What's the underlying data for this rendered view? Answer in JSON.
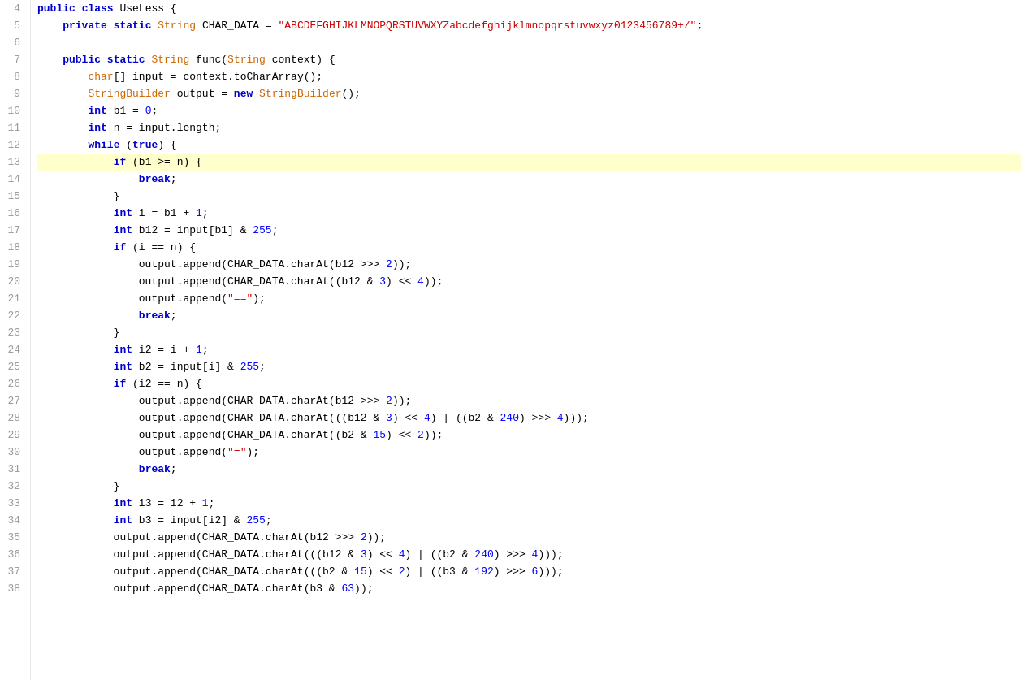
{
  "editor": {
    "lines": [
      {
        "num": 4,
        "highlighted": false,
        "tokens": [
          {
            "t": "kw",
            "v": "public"
          },
          {
            "t": "op",
            "v": " "
          },
          {
            "t": "kw",
            "v": "class"
          },
          {
            "t": "op",
            "v": " "
          },
          {
            "t": "classname",
            "v": "UseLess"
          },
          {
            "t": "op",
            "v": " {"
          }
        ]
      },
      {
        "num": 5,
        "highlighted": false,
        "tokens": [
          {
            "t": "op",
            "v": "    "
          },
          {
            "t": "kw",
            "v": "private"
          },
          {
            "t": "op",
            "v": " "
          },
          {
            "t": "kw",
            "v": "static"
          },
          {
            "t": "op",
            "v": " "
          },
          {
            "t": "type",
            "v": "String"
          },
          {
            "t": "op",
            "v": " CHAR_DATA = "
          },
          {
            "t": "str",
            "v": "\"ABCDEFGHIJKLMNOPQRSTUVWXYZabcdefghijklmnopqrstuvwxyz0123456789+/\""
          },
          {
            "t": "op",
            "v": ";"
          }
        ]
      },
      {
        "num": 6,
        "highlighted": false,
        "tokens": []
      },
      {
        "num": 7,
        "highlighted": false,
        "tokens": [
          {
            "t": "op",
            "v": "    "
          },
          {
            "t": "kw",
            "v": "public"
          },
          {
            "t": "op",
            "v": " "
          },
          {
            "t": "kw",
            "v": "static"
          },
          {
            "t": "op",
            "v": " "
          },
          {
            "t": "type",
            "v": "String"
          },
          {
            "t": "op",
            "v": " func("
          },
          {
            "t": "type",
            "v": "String"
          },
          {
            "t": "op",
            "v": " context) {"
          }
        ]
      },
      {
        "num": 8,
        "highlighted": false,
        "tokens": [
          {
            "t": "op",
            "v": "        "
          },
          {
            "t": "type",
            "v": "char"
          },
          {
            "t": "op",
            "v": "[] input = context.toCharArray();"
          }
        ]
      },
      {
        "num": 9,
        "highlighted": false,
        "tokens": [
          {
            "t": "op",
            "v": "        "
          },
          {
            "t": "type",
            "v": "StringBuilder"
          },
          {
            "t": "op",
            "v": " output = "
          },
          {
            "t": "kw",
            "v": "new"
          },
          {
            "t": "op",
            "v": " "
          },
          {
            "t": "type",
            "v": "StringBuilder"
          },
          {
            "t": "op",
            "v": "();"
          }
        ]
      },
      {
        "num": 10,
        "highlighted": false,
        "tokens": [
          {
            "t": "op",
            "v": "        "
          },
          {
            "t": "kw",
            "v": "int"
          },
          {
            "t": "op",
            "v": " b1 = "
          },
          {
            "t": "num",
            "v": "0"
          },
          {
            "t": "op",
            "v": ";"
          }
        ]
      },
      {
        "num": 11,
        "highlighted": false,
        "tokens": [
          {
            "t": "op",
            "v": "        "
          },
          {
            "t": "kw",
            "v": "int"
          },
          {
            "t": "op",
            "v": " n = input.length;"
          }
        ]
      },
      {
        "num": 12,
        "highlighted": false,
        "tokens": [
          {
            "t": "op",
            "v": "        "
          },
          {
            "t": "kw",
            "v": "while"
          },
          {
            "t": "op",
            "v": " ("
          },
          {
            "t": "kw",
            "v": "true"
          },
          {
            "t": "op",
            "v": ") {"
          }
        ]
      },
      {
        "num": 13,
        "highlighted": true,
        "tokens": [
          {
            "t": "op",
            "v": "            "
          },
          {
            "t": "kw",
            "v": "if"
          },
          {
            "t": "op",
            "v": " (b1 >= n) {"
          }
        ]
      },
      {
        "num": 14,
        "highlighted": false,
        "tokens": [
          {
            "t": "op",
            "v": "                "
          },
          {
            "t": "kw",
            "v": "break"
          },
          {
            "t": "op",
            "v": ";"
          }
        ]
      },
      {
        "num": 15,
        "highlighted": false,
        "tokens": [
          {
            "t": "op",
            "v": "            }"
          }
        ]
      },
      {
        "num": 16,
        "highlighted": false,
        "tokens": [
          {
            "t": "op",
            "v": "            "
          },
          {
            "t": "kw",
            "v": "int"
          },
          {
            "t": "op",
            "v": " i = b1 + "
          },
          {
            "t": "num",
            "v": "1"
          },
          {
            "t": "op",
            "v": ";"
          }
        ]
      },
      {
        "num": 17,
        "highlighted": false,
        "tokens": [
          {
            "t": "op",
            "v": "            "
          },
          {
            "t": "kw",
            "v": "int"
          },
          {
            "t": "op",
            "v": " b12 = input[b1] & "
          },
          {
            "t": "num",
            "v": "255"
          },
          {
            "t": "op",
            "v": ";"
          }
        ]
      },
      {
        "num": 18,
        "highlighted": false,
        "tokens": [
          {
            "t": "op",
            "v": "            "
          },
          {
            "t": "kw",
            "v": "if"
          },
          {
            "t": "op",
            "v": " (i == n) {"
          }
        ]
      },
      {
        "num": 19,
        "highlighted": false,
        "tokens": [
          {
            "t": "op",
            "v": "                output.append(CHAR_DATA.charAt(b12 >>> "
          },
          {
            "t": "num",
            "v": "2"
          },
          {
            "t": "op",
            "v": "));"
          }
        ]
      },
      {
        "num": 20,
        "highlighted": false,
        "tokens": [
          {
            "t": "op",
            "v": "                output.append(CHAR_DATA.charAt((b12 & "
          },
          {
            "t": "num",
            "v": "3"
          },
          {
            "t": "op",
            "v": ") << "
          },
          {
            "t": "num",
            "v": "4"
          },
          {
            "t": "op",
            "v": "));"
          }
        ]
      },
      {
        "num": 21,
        "highlighted": false,
        "tokens": [
          {
            "t": "op",
            "v": "                output.append("
          },
          {
            "t": "str",
            "v": "\"==\""
          },
          {
            "t": "op",
            "v": ");"
          }
        ]
      },
      {
        "num": 22,
        "highlighted": false,
        "tokens": [
          {
            "t": "op",
            "v": "                "
          },
          {
            "t": "kw",
            "v": "break"
          },
          {
            "t": "op",
            "v": ";"
          }
        ]
      },
      {
        "num": 23,
        "highlighted": false,
        "tokens": [
          {
            "t": "op",
            "v": "            }"
          }
        ]
      },
      {
        "num": 24,
        "highlighted": false,
        "tokens": [
          {
            "t": "op",
            "v": "            "
          },
          {
            "t": "kw",
            "v": "int"
          },
          {
            "t": "op",
            "v": " i2 = i + "
          },
          {
            "t": "num",
            "v": "1"
          },
          {
            "t": "op",
            "v": ";"
          }
        ]
      },
      {
        "num": 25,
        "highlighted": false,
        "tokens": [
          {
            "t": "op",
            "v": "            "
          },
          {
            "t": "kw",
            "v": "int"
          },
          {
            "t": "op",
            "v": " b2 = input[i] & "
          },
          {
            "t": "num",
            "v": "255"
          },
          {
            "t": "op",
            "v": ";"
          }
        ]
      },
      {
        "num": 26,
        "highlighted": false,
        "tokens": [
          {
            "t": "op",
            "v": "            "
          },
          {
            "t": "kw",
            "v": "if"
          },
          {
            "t": "op",
            "v": " (i2 == n) {"
          }
        ]
      },
      {
        "num": 27,
        "highlighted": false,
        "tokens": [
          {
            "t": "op",
            "v": "                output.append(CHAR_DATA.charAt(b12 >>> "
          },
          {
            "t": "num",
            "v": "2"
          },
          {
            "t": "op",
            "v": "));"
          }
        ]
      },
      {
        "num": 28,
        "highlighted": false,
        "tokens": [
          {
            "t": "op",
            "v": "                output.append(CHAR_DATA.charAt(((b12 & "
          },
          {
            "t": "num",
            "v": "3"
          },
          {
            "t": "op",
            "v": ") << "
          },
          {
            "t": "num",
            "v": "4"
          },
          {
            "t": "op",
            "v": ") | ((b2 & "
          },
          {
            "t": "num",
            "v": "240"
          },
          {
            "t": "op",
            "v": ") >>> "
          },
          {
            "t": "num",
            "v": "4"
          },
          {
            "t": "op",
            "v": ")));"
          }
        ]
      },
      {
        "num": 29,
        "highlighted": false,
        "tokens": [
          {
            "t": "op",
            "v": "                output.append(CHAR_DATA.charAt((b2 & "
          },
          {
            "t": "num",
            "v": "15"
          },
          {
            "t": "op",
            "v": ") << "
          },
          {
            "t": "num",
            "v": "2"
          },
          {
            "t": "op",
            "v": "));"
          }
        ]
      },
      {
        "num": 30,
        "highlighted": false,
        "tokens": [
          {
            "t": "op",
            "v": "                output.append("
          },
          {
            "t": "str",
            "v": "\"=\""
          },
          {
            "t": "op",
            "v": ");"
          }
        ]
      },
      {
        "num": 31,
        "highlighted": false,
        "tokens": [
          {
            "t": "op",
            "v": "                "
          },
          {
            "t": "kw",
            "v": "break"
          },
          {
            "t": "op",
            "v": ";"
          }
        ]
      },
      {
        "num": 32,
        "highlighted": false,
        "tokens": [
          {
            "t": "op",
            "v": "            }"
          }
        ]
      },
      {
        "num": 33,
        "highlighted": false,
        "tokens": [
          {
            "t": "op",
            "v": "            "
          },
          {
            "t": "kw",
            "v": "int"
          },
          {
            "t": "op",
            "v": " i3 = i2 + "
          },
          {
            "t": "num",
            "v": "1"
          },
          {
            "t": "op",
            "v": ";"
          }
        ]
      },
      {
        "num": 34,
        "highlighted": false,
        "tokens": [
          {
            "t": "op",
            "v": "            "
          },
          {
            "t": "kw",
            "v": "int"
          },
          {
            "t": "op",
            "v": " b3 = input[i2] & "
          },
          {
            "t": "num",
            "v": "255"
          },
          {
            "t": "op",
            "v": ";"
          }
        ]
      },
      {
        "num": 35,
        "highlighted": false,
        "tokens": [
          {
            "t": "op",
            "v": "            output.append(CHAR_DATA.charAt(b12 >>> "
          },
          {
            "t": "num",
            "v": "2"
          },
          {
            "t": "op",
            "v": "));"
          }
        ]
      },
      {
        "num": 36,
        "highlighted": false,
        "tokens": [
          {
            "t": "op",
            "v": "            output.append(CHAR_DATA.charAt(((b12 & "
          },
          {
            "t": "num",
            "v": "3"
          },
          {
            "t": "op",
            "v": ") << "
          },
          {
            "t": "num",
            "v": "4"
          },
          {
            "t": "op",
            "v": ") | ((b2 & "
          },
          {
            "t": "num",
            "v": "240"
          },
          {
            "t": "op",
            "v": ") >>> "
          },
          {
            "t": "num",
            "v": "4"
          },
          {
            "t": "op",
            "v": ")));"
          }
        ]
      },
      {
        "num": 37,
        "highlighted": false,
        "tokens": [
          {
            "t": "op",
            "v": "            output.append(CHAR_DATA.charAt(((b2 & "
          },
          {
            "t": "num",
            "v": "15"
          },
          {
            "t": "op",
            "v": ") << "
          },
          {
            "t": "num",
            "v": "2"
          },
          {
            "t": "op",
            "v": ") | ((b3 & "
          },
          {
            "t": "num",
            "v": "192"
          },
          {
            "t": "op",
            "v": ") >>> "
          },
          {
            "t": "num",
            "v": "6"
          },
          {
            "t": "op",
            "v": ")));"
          }
        ]
      },
      {
        "num": 38,
        "highlighted": false,
        "tokens": [
          {
            "t": "op",
            "v": "            output.append(CHAR_DATA.charAt(b3 & "
          },
          {
            "t": "num",
            "v": "63"
          },
          {
            "t": "op",
            "v": "));"
          }
        ]
      }
    ]
  }
}
